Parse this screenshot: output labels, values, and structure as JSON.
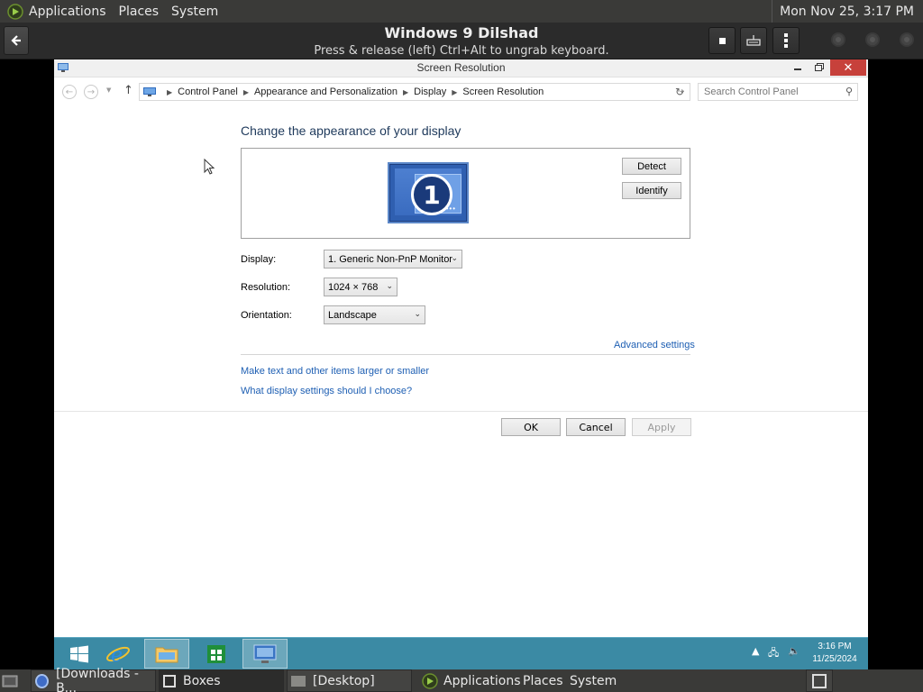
{
  "gnome_top": {
    "applications": "Applications",
    "places": "Places",
    "system": "System",
    "clock": "Mon Nov 25,  3:17 PM"
  },
  "boxes": {
    "title": "Windows 9 Dilshad",
    "subtitle": "Press & release (left) Ctrl+Alt to ungrab keyboard."
  },
  "window": {
    "title": "Screen Resolution"
  },
  "address": {
    "crumbs": [
      "Control Panel",
      "Appearance and Personalization",
      "Display",
      "Screen Resolution"
    ],
    "search_placeholder": "Search Control Panel"
  },
  "main": {
    "heading": "Change the appearance of your display",
    "monitor_number": "1",
    "detect": "Detect",
    "identify": "Identify",
    "display_label": "Display:",
    "display_value": "1. Generic Non-PnP Monitor",
    "resolution_label": "Resolution:",
    "resolution_value": "1024 × 768",
    "orientation_label": "Orientation:",
    "orientation_value": "Landscape",
    "advanced_settings": "Advanced settings",
    "link_text_size": "Make text and other items larger or smaller",
    "link_help": "What display settings should I choose?",
    "ok": "OK",
    "cancel": "Cancel",
    "apply": "Apply"
  },
  "taskbar": {
    "time": "3:16 PM",
    "date": "11/25/2024"
  },
  "gnome_bottom": {
    "downloads": "[Downloads - B...",
    "boxes": "Boxes",
    "desktop": "[Desktop]",
    "applications": "Applications",
    "places": "Places",
    "system": "System"
  }
}
